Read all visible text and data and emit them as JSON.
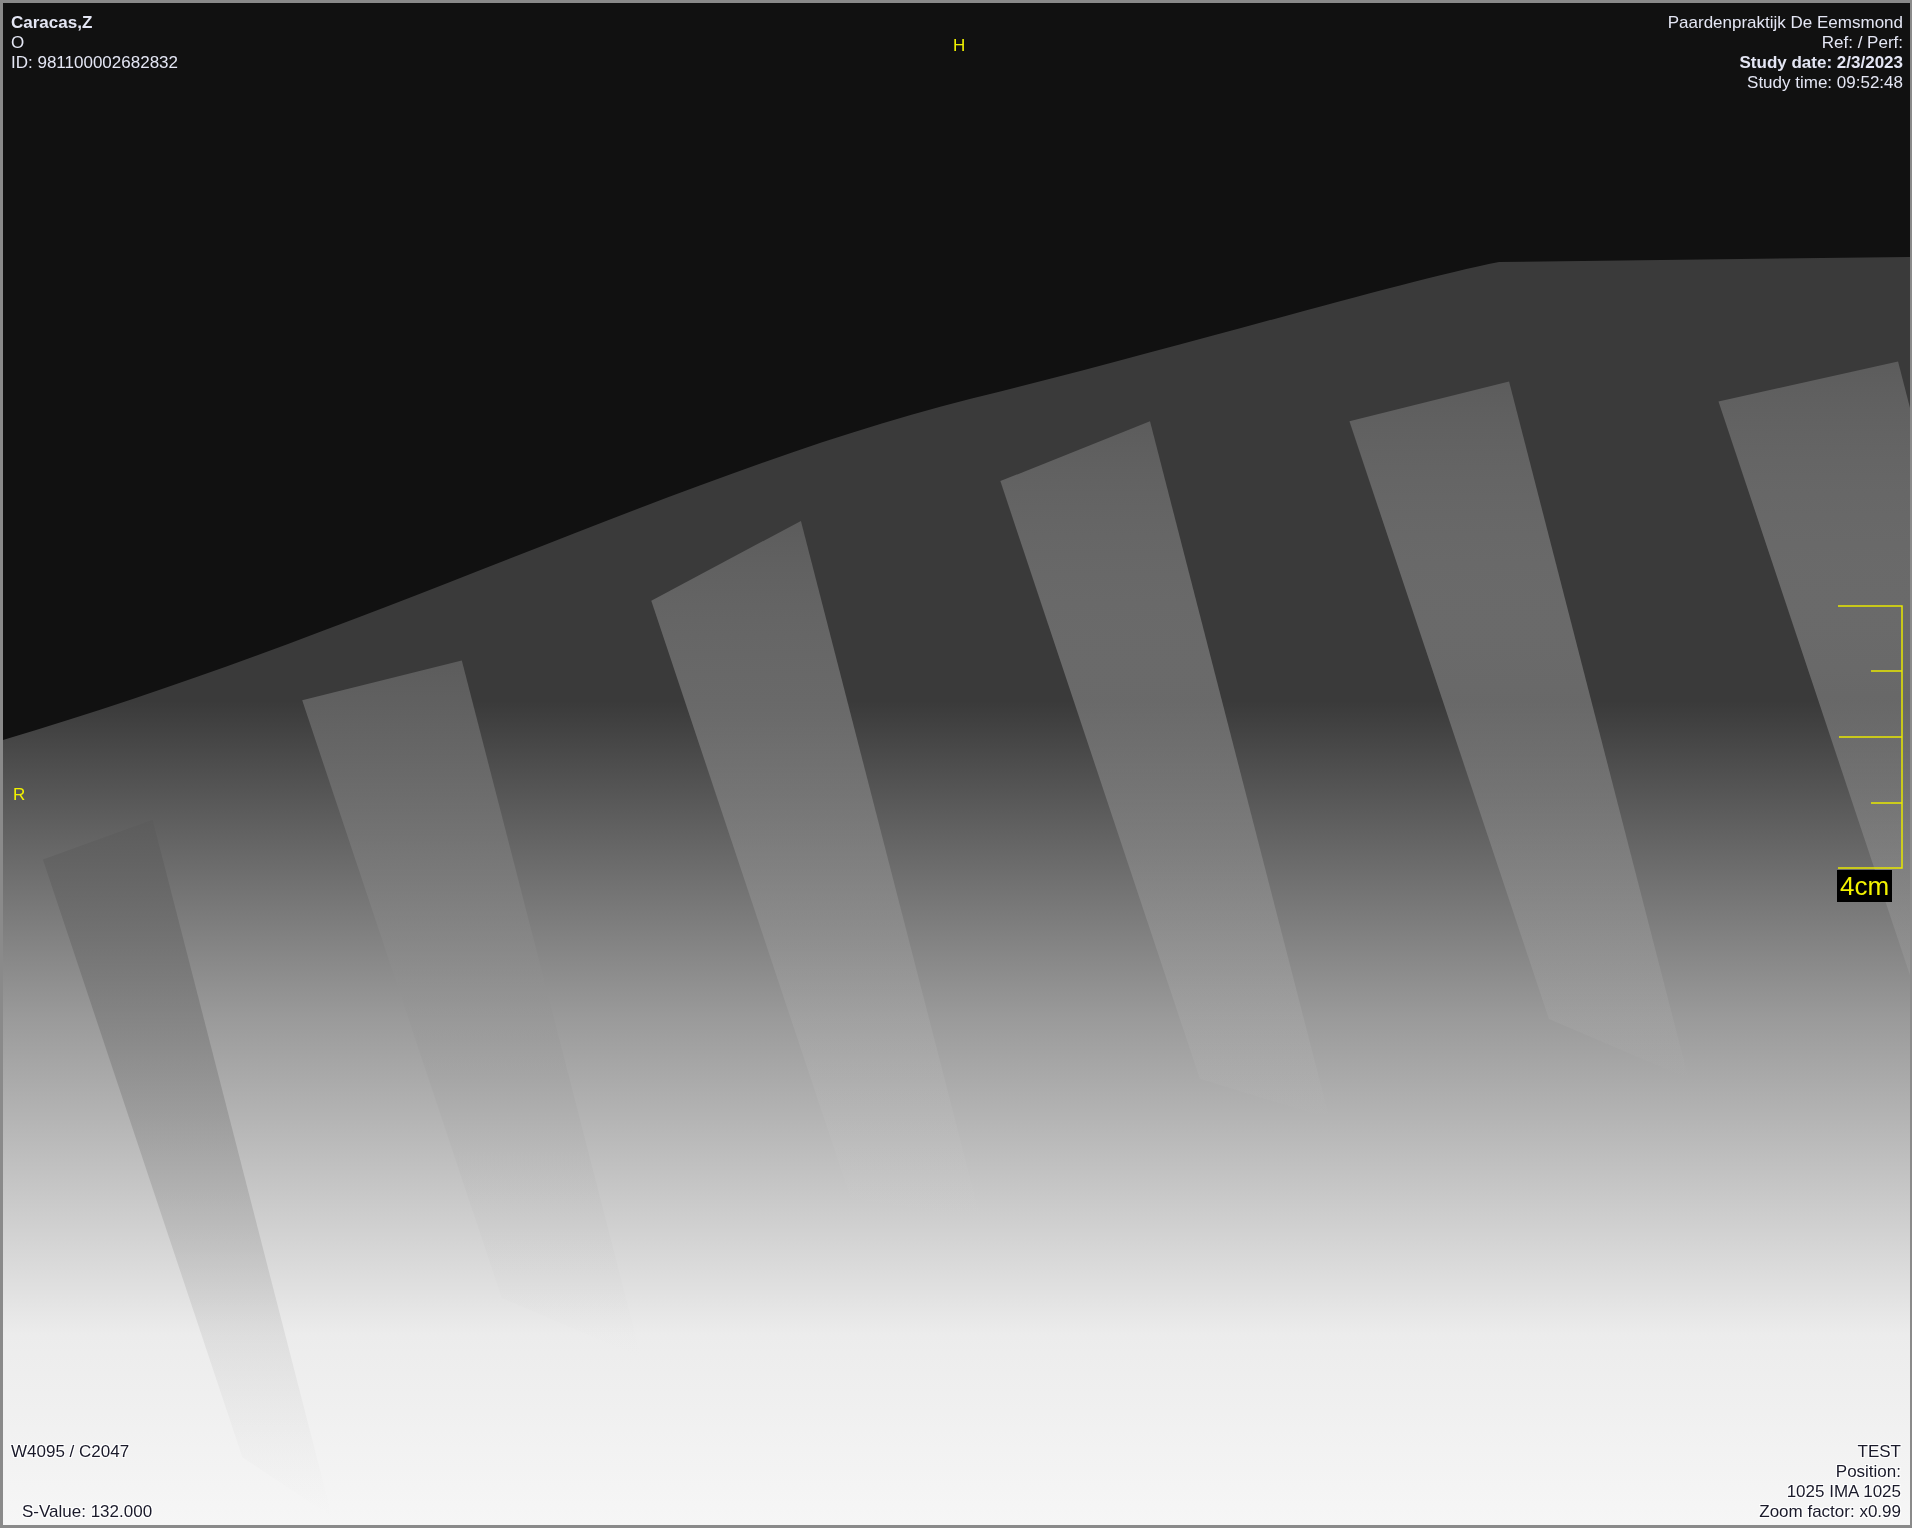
{
  "patient": {
    "name": "Caracas,Z",
    "sex": "O",
    "id": "ID: 981100002682832"
  },
  "study": {
    "practice": "Paardenpraktijk De Eemsmond",
    "ref": "Ref:  / Perf:",
    "date": "Study date: 2/3/2023",
    "time": "Study time: 09:52:48"
  },
  "orientation": {
    "top": "H",
    "left": "R"
  },
  "scale": {
    "label": "4cm"
  },
  "bottom_left": {
    "window": "W4095 / C2047",
    "s_value": "S-Value: 132.000"
  },
  "bottom_right": [
    "TEST",
    "Position:",
    "1025 IMA 1025",
    "Zoom factor: x0.99"
  ]
}
